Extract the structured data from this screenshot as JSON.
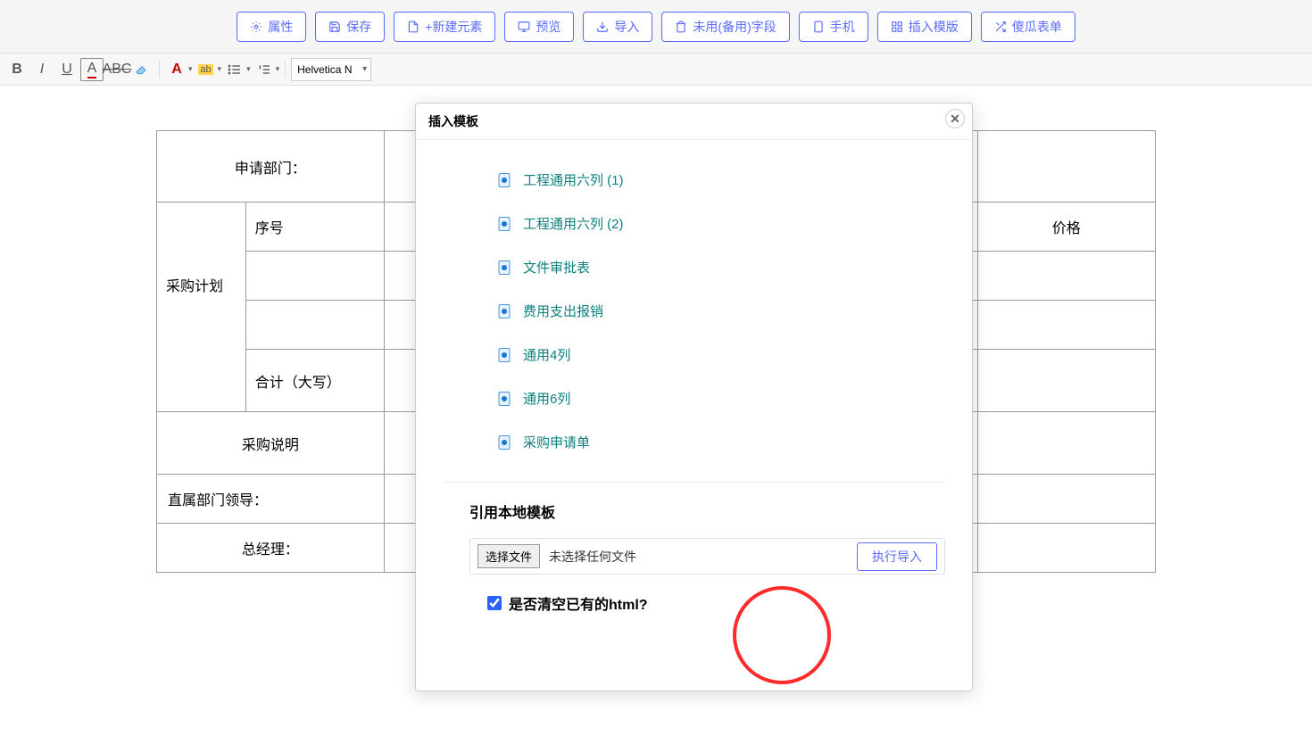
{
  "toolbar": {
    "attributes": "属性",
    "save": "保存",
    "new_element": "+新建元素",
    "preview": "预览",
    "import": "导入",
    "unused_fields": "未用(备用)字段",
    "mobile": "手机",
    "insert_template": "插入模版",
    "simple_form": "傻瓜表单"
  },
  "editor": {
    "font_family": "Helvetica N"
  },
  "form": {
    "dept_label": "申请部门：",
    "plan_label": "采购计划",
    "seq_label": "序号",
    "price_label": "价格",
    "total_label": "合计（大写）",
    "desc_label": "采购说明",
    "direct_leader_label": "直属部门领导：",
    "gm_label": "总经理："
  },
  "modal": {
    "title": "插入模板",
    "templates": [
      "工程通用六列 (1)",
      "工程通用六列 (2)",
      "文件审批表",
      "费用支出报销",
      "通用4列",
      "通用6列",
      "采购申请单"
    ],
    "local_title": "引用本地模板",
    "choose_file": "选择文件",
    "no_file": "未选择任何文件",
    "do_import": "执行导入",
    "clear_label": "是否清空已有的html?"
  }
}
